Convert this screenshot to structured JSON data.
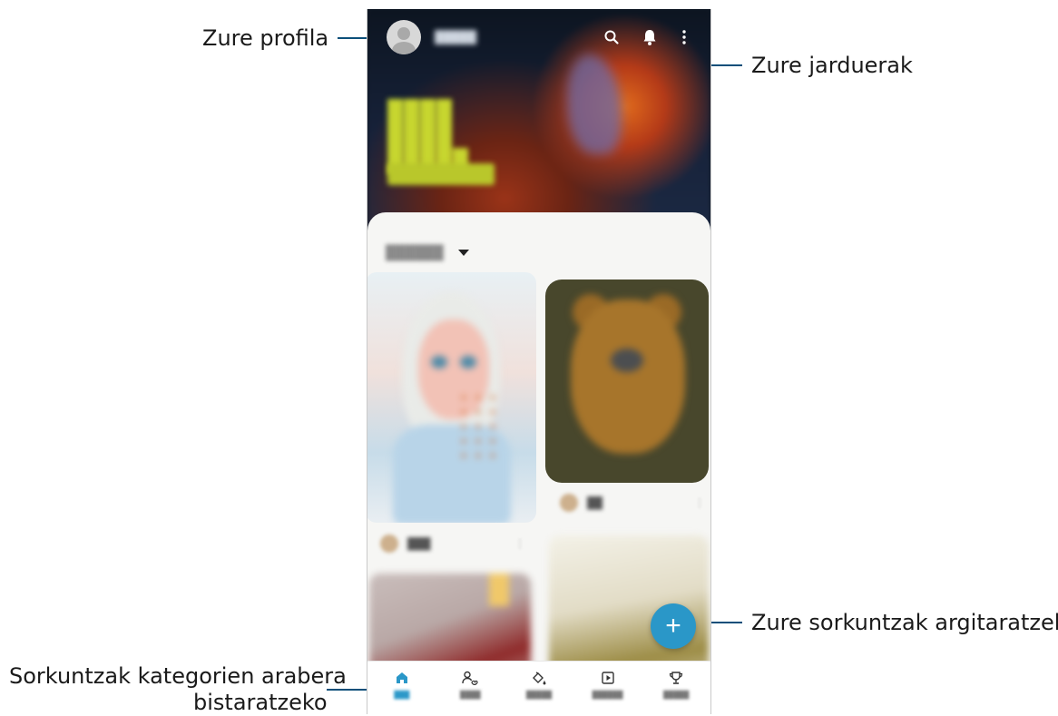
{
  "callouts": {
    "profile": "Zure profila",
    "activities": "Zure jarduerak",
    "publish": "Zure sorkuntzak argitaratzeko",
    "categories_line1": "Sorkuntzak kategorien arabera",
    "categories_line2": "bistaratzeko"
  },
  "topbar": {
    "icons": [
      "avatar",
      "search-icon",
      "bell-icon",
      "more-vert-icon"
    ]
  },
  "fab": {
    "label": "+"
  },
  "navbar": {
    "items": [
      {
        "icon": "home-icon",
        "active": true
      },
      {
        "icon": "my-feed-icon",
        "active": false
      },
      {
        "icon": "coloring-icon",
        "active": false
      },
      {
        "icon": "live-drawing-icon",
        "active": false
      },
      {
        "icon": "trophy-icon",
        "active": false
      }
    ]
  },
  "colors": {
    "accent": "#2a97c8",
    "callout_line": "#0c4f7a",
    "sheet_background": "#f6f6f4",
    "hero_text": "#c7d62f"
  }
}
